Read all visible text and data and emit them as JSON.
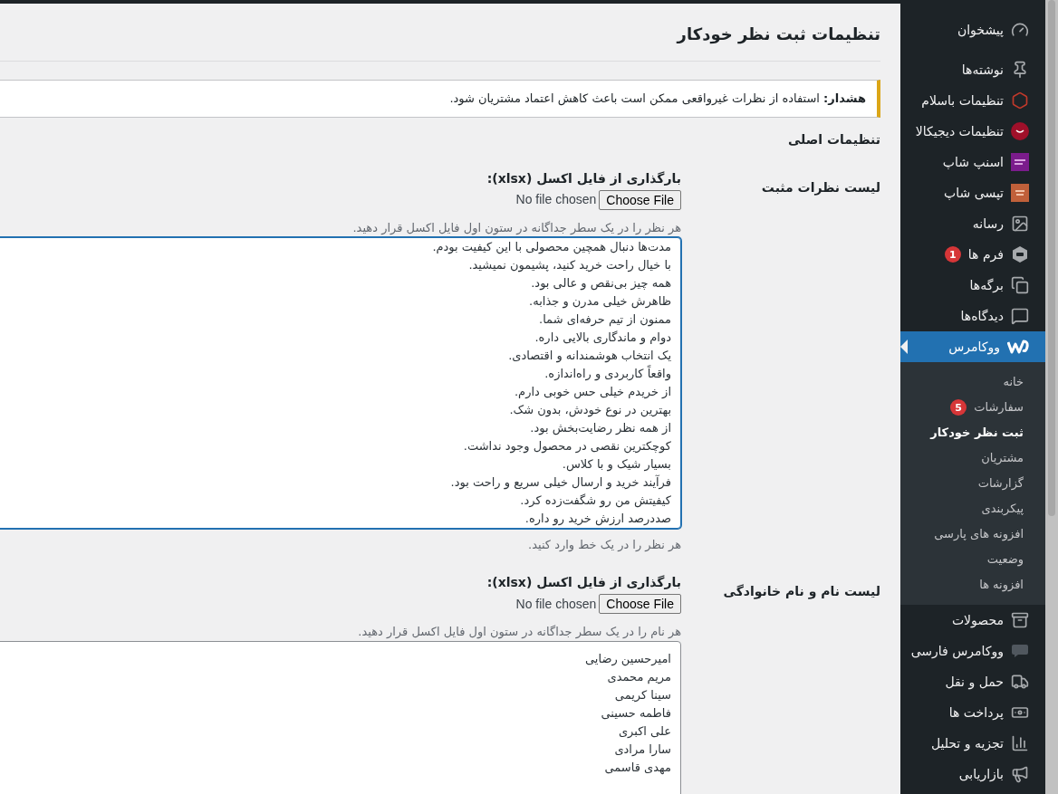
{
  "page_title": "تنظیمات ثبت نظر خودکار",
  "notice": {
    "text": "**هشدار:** استفاده از نظرات غیرواقعی ممکن است باعث کاهش اعتماد مشتریان شود."
  },
  "section_title": "تنظیمات اصلی",
  "rows": [
    {
      "label": "لیست نظرات مثبت",
      "upload_label": "بارگذاری از فایل اکسل (xlsx):",
      "file_status": "No file chosen",
      "file_button": "Choose File",
      "upload_hint": "هر نظر را در یک سطر جداگانه در ستون اول فایل اکسل قرار دهید.",
      "first_line": "مدت‌ها دنبال همچین محصولی با این کیفیت بودم.",
      "lines": [
        "با خیال راحت خرید کنید، پشیمون نمیشید.",
        "همه چیز بی‌نقص و عالی بود.",
        "ظاهرش خیلی مدرن و جذابه.",
        "ممنون از تیم حرفه‌ای شما.",
        "دوام و ماندگاری بالایی داره.",
        "یک انتخاب هوشمندانه و اقتصادی.",
        "واقعاً کاربردی و راه‌اندازه.",
        "از خریدم خیلی حس خوبی دارم.",
        "بهترین در نوع خودش، بدون شک.",
        "از همه نظر رضایت‌بخش بود.",
        "کوچکترین نقصی در محصول وجود نداشت.",
        "بسیار شیک و با کلاس.",
        "فرآیند خرید و ارسال خیلی سریع و راحت بود.",
        "کیفیتش من رو شگفت‌زده کرد.",
        "صددرصد ارزش خرید رو داره."
      ],
      "focused": true,
      "description": "هر نظر را در یک خط وارد کنید."
    },
    {
      "label": "لیست نام و نام خانوادگی",
      "upload_label": "بارگذاری از فایل اکسل (xlsx):",
      "file_status": "No file chosen",
      "file_button": "Choose File",
      "upload_hint": "هر نام را در یک سطر جداگانه در ستون اول فایل اکسل قرار دهید.",
      "lines": [
        "امیرحسین رضایی",
        "مریم محمدی",
        "سینا کریمی",
        "فاطمه حسینی",
        "علی اکبری",
        "سارا مرادی",
        "مهدی قاسمی"
      ],
      "focused": false
    }
  ],
  "sidebar": {
    "items": [
      {
        "label": "پیشخوان",
        "kind": "dashboard",
        "selected": false
      },
      {
        "label": "نوشته‌ها",
        "kind": "pin",
        "selected": false
      },
      {
        "label": "تنظیمات باسلام",
        "kind": "hexagon",
        "selected": false
      },
      {
        "label": "تنظیمات دیجیکالا",
        "kind": "digikala",
        "selected": false
      },
      {
        "label": "اسنپ شاپ",
        "kind": "snapp",
        "selected": false
      },
      {
        "label": "تپسی شاپ",
        "kind": "tapsi",
        "selected": false
      },
      {
        "label": "رسانه",
        "kind": "media",
        "selected": false
      },
      {
        "label": "فرم ها",
        "kind": "forms",
        "selected": false,
        "badge": "1"
      },
      {
        "label": "برگه‌ها",
        "kind": "pages",
        "selected": false
      },
      {
        "label": "دیدگاه‌ها",
        "kind": "comments",
        "selected": false
      },
      {
        "label": "ووکامرس",
        "kind": "woo",
        "selected": true,
        "children": [
          {
            "label": "خانه",
            "selected": false
          },
          {
            "label": "سفارشات",
            "selected": false,
            "badge": "5"
          },
          {
            "label": "ثبت نظر خودکار",
            "selected": true
          },
          {
            "label": "مشتریان",
            "selected": false
          },
          {
            "label": "گزارشات",
            "selected": false
          },
          {
            "label": "پیکربندی",
            "selected": false
          },
          {
            "label": "افزونه های پارسی",
            "selected": false
          },
          {
            "label": "وضعیت",
            "selected": false
          },
          {
            "label": "افزونه ها",
            "selected": false
          }
        ]
      },
      {
        "label": "محصولات",
        "kind": "archive",
        "selected": false
      },
      {
        "label": "ووکامرس فارسی",
        "kind": "bubble",
        "selected": false
      },
      {
        "label": "حمل و نقل",
        "kind": "truck",
        "selected": false
      },
      {
        "label": "پرداخت ها",
        "kind": "money",
        "selected": false
      },
      {
        "label": "تجزیه و تحلیل",
        "kind": "chart",
        "selected": false
      },
      {
        "label": "بازاریابی",
        "kind": "megaphone",
        "selected": false
      }
    ]
  }
}
